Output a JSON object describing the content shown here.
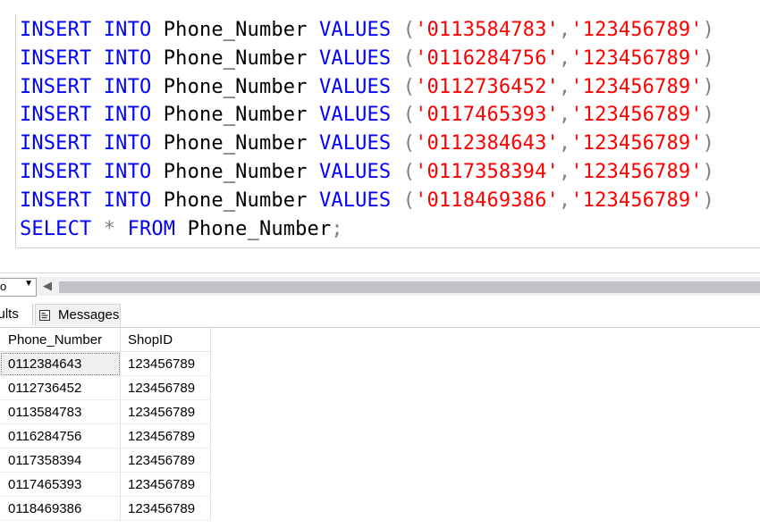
{
  "editor": {
    "insert_lines": [
      {
        "phone": "0113584783",
        "shop": "123456789"
      },
      {
        "phone": "0116284756",
        "shop": "123456789"
      },
      {
        "phone": "0112736452",
        "shop": "123456789"
      },
      {
        "phone": "0117465393",
        "shop": "123456789"
      },
      {
        "phone": "0112384643",
        "shop": "123456789"
      },
      {
        "phone": "0117358394",
        "shop": "123456789"
      },
      {
        "phone": "0118469386",
        "shop": "123456789"
      }
    ],
    "kw_insert": "INSERT",
    "kw_into": "INTO",
    "kw_values": "VALUES",
    "kw_select": "SELECT",
    "kw_from": "FROM",
    "table_name": "Phone_Number",
    "star": "*"
  },
  "zoom": {
    "value": "o"
  },
  "tabs": {
    "results_label": "sults",
    "messages_label": "Messages"
  },
  "grid": {
    "columns": [
      "Phone_Number",
      "ShopID"
    ],
    "rows": [
      [
        "0112384643",
        "123456789"
      ],
      [
        "0112736452",
        "123456789"
      ],
      [
        "0113584783",
        "123456789"
      ],
      [
        "0116284756",
        "123456789"
      ],
      [
        "0117358394",
        "123456789"
      ],
      [
        "0117465393",
        "123456789"
      ],
      [
        "0118469386",
        "123456789"
      ]
    ]
  },
  "colors": {
    "keyword": "#0000ff",
    "string": "#ff0000",
    "punct": "#808080",
    "scroll_thumb": "#c2c3c9"
  }
}
